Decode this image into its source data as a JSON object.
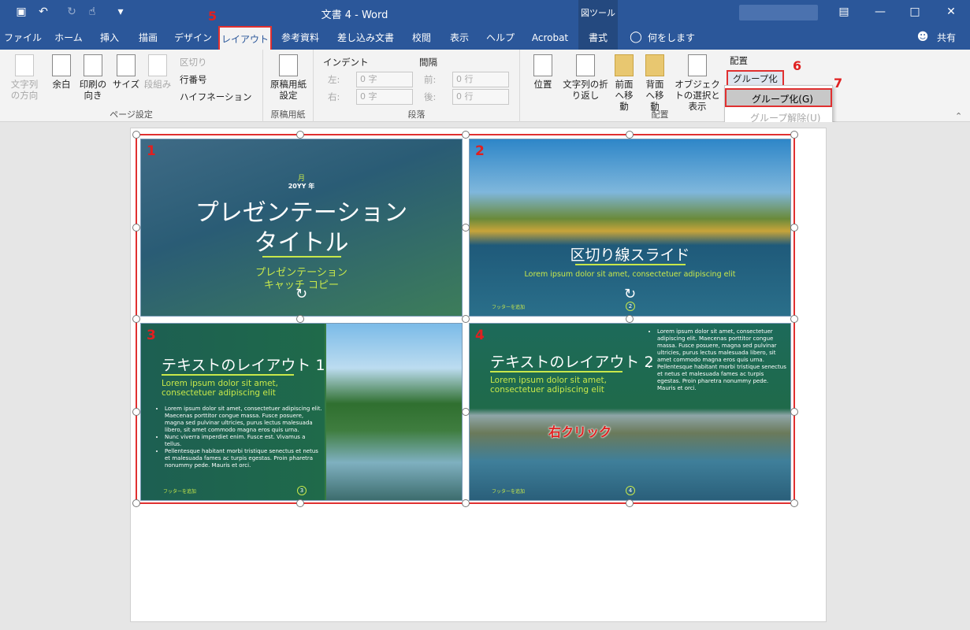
{
  "titlebar": {
    "title": "文書 4 - Word",
    "tool_context": "図ツール",
    "icons": [
      "save-icon",
      "undo-icon",
      "redo-icon",
      "touch-mode-icon",
      "customize-icon"
    ]
  },
  "tabs": [
    "ファイル",
    "ホーム",
    "挿入",
    "描画",
    "デザイン",
    "レイアウト",
    "参考資料",
    "差し込み文書",
    "校閲",
    "表示",
    "ヘルプ",
    "Acrobat",
    "書式"
  ],
  "tell_me": "何をしますか",
  "share": "共有",
  "ribbon": {
    "page_setup": {
      "label": "ページ設定",
      "text_dir": "文字列の方向",
      "margins": "余白",
      "orientation": "印刷の向き",
      "size": "サイズ",
      "columns": "段組み",
      "breaks": "区切り",
      "line_numbers": "行番号",
      "hyphenation": "ハイフネーション"
    },
    "manuscript": {
      "label": "原稿用紙",
      "btn": "原稿用紙設定"
    },
    "paragraph": {
      "label": "段落",
      "indent": "インデント",
      "spacing": "間隔",
      "left": "左:",
      "right": "右:",
      "before": "前:",
      "after": "後:",
      "indent_value": "0 字",
      "spacing_value": "0 行"
    },
    "arrange": {
      "label": "配置",
      "position": "位置",
      "wrap": "文字列の折り返し",
      "forward": "前面へ移動",
      "backward": "背面へ移動",
      "selection": "オブジェクトの選択と表示",
      "align": "配置",
      "group": "グループ化"
    }
  },
  "dropdown": {
    "items": [
      "グループ化(G)",
      "グループ解除(U)"
    ]
  },
  "callouts": [
    "1",
    "2",
    "3",
    "4",
    "5",
    "6",
    "7"
  ],
  "annotation": "右クリック",
  "slides": {
    "s1": {
      "month": "月",
      "year": "20YY 年",
      "title1": "プレゼンテーション",
      "title2": "タイトル",
      "sub1": "プレゼンテーション",
      "sub2": "キャッチ コピー"
    },
    "s2": {
      "title": "区切り線スライド",
      "sub": "Lorem ipsum dolor sit amet, consectetuer adipiscing elit",
      "footer": "フッターを追加",
      "page": "2"
    },
    "s3": {
      "title": "テキストのレイアウト 1",
      "sub1": "Lorem ipsum dolor sit amet,",
      "sub2": "consectetuer adipiscing elit",
      "bullets": [
        "Lorem ipsum dolor sit amet, consectetuer adipiscing elit. Maecenas porttitor congue massa. Fusce posuere, magna sed pulvinar ultricies, purus lectus malesuada libero, sit amet commodo magna eros quis urna.",
        "Nunc viverra imperdiet enim. Fusce est. Vivamus a tellus.",
        "Pellentesque habitant morbi tristique senectus et netus et malesuada fames ac turpis egestas. Proin pharetra nonummy pede. Mauris et orci."
      ],
      "footer": "フッターを追加",
      "page": "3"
    },
    "s4": {
      "title": "テキストのレイアウト 2",
      "sub1": "Lorem ipsum dolor sit amet,",
      "sub2": "consectetuer adipiscing elit",
      "bullets": [
        "Lorem ipsum dolor sit amet, consectetuer adipiscing elit. Maecenas porttitor congue massa. Fusce posuere, magna sed pulvinar ultricies, purus lectus malesuada libero, sit amet commodo magna eros quis urna.",
        "Pellentesque habitant morbi tristique senectus et netus et malesuada fames ac turpis egestas. Proin pharetra nonummy pede. Mauris et orci."
      ],
      "footer": "フッターを追加",
      "page": "4"
    }
  },
  "colors": {
    "brand": "#2b579a",
    "accent_red": "#e03030",
    "slide_green": "#c8e84a"
  }
}
